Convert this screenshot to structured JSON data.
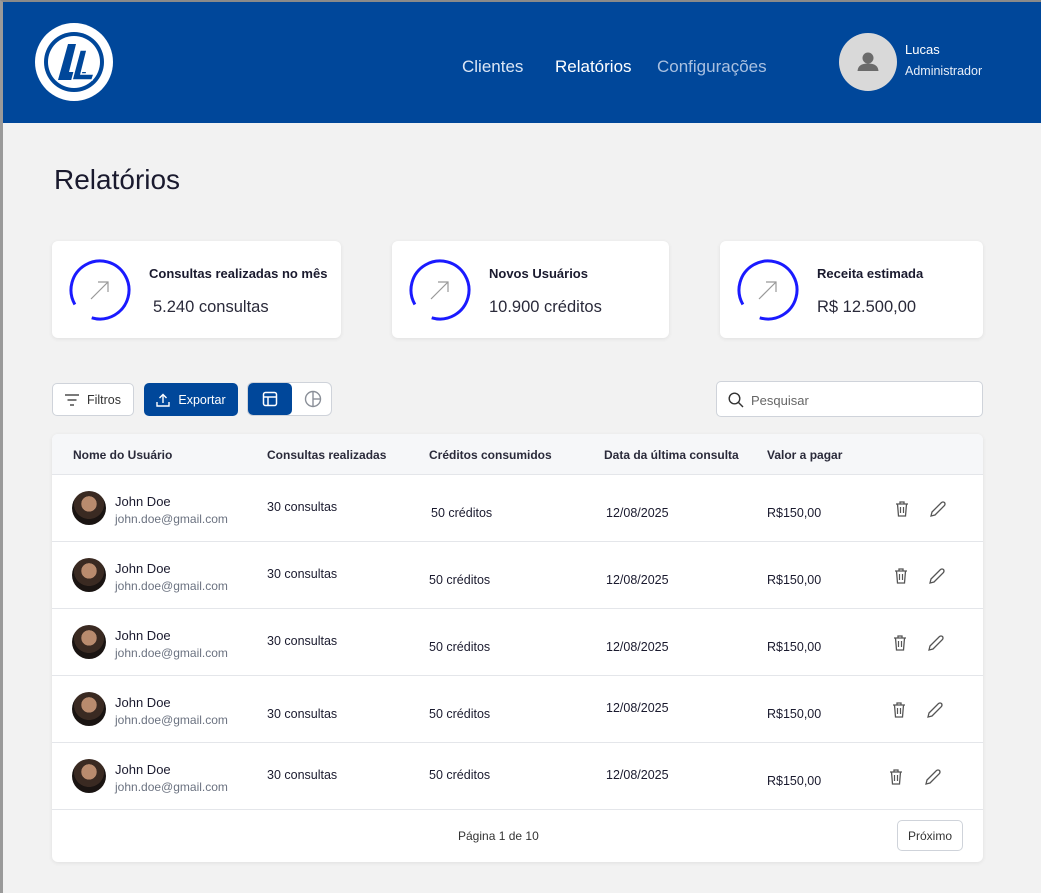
{
  "header": {
    "logo_text": "GRUPO LL",
    "nav": [
      "Clientes",
      "Relatórios",
      "Configurações"
    ],
    "user": {
      "name": "Lucas",
      "role": "Administrador"
    }
  },
  "page_title": "Relatórios",
  "cards": [
    {
      "title": "Consultas realizadas no mês",
      "value": "5.240 consultas"
    },
    {
      "title": "Novos Usuários",
      "value": "10.900 créditos"
    },
    {
      "title": "Receita estimada",
      "value": "R$ 12.500,00"
    }
  ],
  "toolbar": {
    "filter_label": "Filtros",
    "export_label": "Exportar",
    "search_placeholder": "Pesquisar"
  },
  "table": {
    "headers": [
      "Nome do Usuário",
      "Consultas realizadas",
      "Créditos consumidos",
      "Data da última consulta",
      "Valor a pagar"
    ],
    "rows": [
      {
        "name": "John Doe",
        "email": "john.doe@gmail.com",
        "consultas": "30 consultas",
        "creditos": "50 créditos",
        "data": "12/08/2025",
        "valor": "R$150,00"
      },
      {
        "name": "John Doe",
        "email": "john.doe@gmail.com",
        "consultas": "30 consultas",
        "creditos": "50 créditos",
        "data": "12/08/2025",
        "valor": "R$150,00"
      },
      {
        "name": "John Doe",
        "email": "john.doe@gmail.com",
        "consultas": "30 consultas",
        "creditos": "50 créditos",
        "data": "12/08/2025",
        "valor": "R$150,00"
      },
      {
        "name": "John Doe",
        "email": "john.doe@gmail.com",
        "consultas": "30 consultas",
        "creditos": "50 créditos",
        "data": "12/08/2025",
        "valor": "R$150,00"
      },
      {
        "name": "John Doe",
        "email": "john.doe@gmail.com",
        "consultas": "30 consultas",
        "creditos": "50 créditos",
        "data": "12/08/2025",
        "valor": "R$150,00"
      }
    ],
    "pagination": "Página 1 de 10",
    "next_label": "Próximo"
  },
  "colors": {
    "brand": "#00479a",
    "ring": "#1a1aff"
  }
}
